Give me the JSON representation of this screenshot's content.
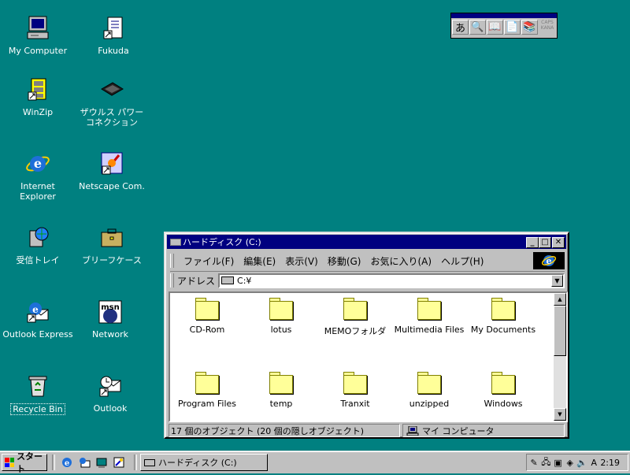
{
  "desktop": {
    "icons": [
      {
        "label": "My Computer"
      },
      {
        "label": "Fukuda"
      },
      {
        "label": "WinZip"
      },
      {
        "label": "ザウルス パワー\nコネクション"
      },
      {
        "label": "Internet Explorer"
      },
      {
        "label": "Netscape Com."
      },
      {
        "label": "受信トレイ"
      },
      {
        "label": "ブリーフケース"
      },
      {
        "label": "Outlook Express"
      },
      {
        "label": "Network"
      },
      {
        "label": "Recycle Bin"
      },
      {
        "label": "Outlook"
      }
    ]
  },
  "ime_toolbar": {
    "buttons": [
      "あ",
      "🔍",
      "📖",
      "📄",
      "📚"
    ],
    "caps": "CAPS",
    "kana": "KANA"
  },
  "window": {
    "title": "ハードディスク (C:)",
    "controls": {
      "minimize": "_",
      "maximize": "□",
      "close": "✕"
    },
    "menu": [
      "ファイル(F)",
      "編集(E)",
      "表示(V)",
      "移動(G)",
      "お気に入り(A)",
      "ヘルプ(H)"
    ],
    "address_label": "アドレス",
    "address_value": "C:¥",
    "folders": [
      {
        "label": "CD-Rom"
      },
      {
        "label": "lotus"
      },
      {
        "label": "MEMOフォルダ"
      },
      {
        "label": "Multimedia Files"
      },
      {
        "label": "My Documents"
      },
      {
        "label": "Program Files"
      },
      {
        "label": "temp"
      },
      {
        "label": "Tranxit"
      },
      {
        "label": "unzipped"
      },
      {
        "label": "Windows"
      }
    ],
    "status_objects": "17 個のオブジェクト (20 個の隠しオブジェクト)",
    "status_location": "マイ コンピュータ"
  },
  "taskbar": {
    "start_label": "スタート",
    "task_label": "ハードディスク (C:)",
    "clock": "2:19"
  },
  "colors": {
    "desktop": "#008080",
    "title_bar": "#000080",
    "face": "#c0c0c0"
  }
}
